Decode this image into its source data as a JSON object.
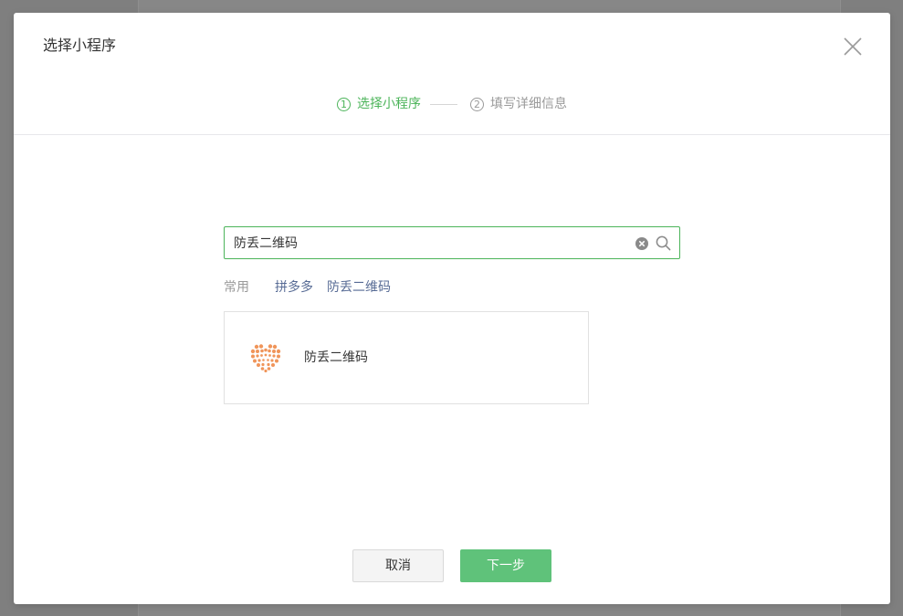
{
  "dialog": {
    "title": "选择小程序",
    "close_icon": "close-icon"
  },
  "steps": [
    {
      "number": "1",
      "label": "选择小程序",
      "state": "active"
    },
    {
      "number": "2",
      "label": "填写详细信息",
      "state": "inactive"
    }
  ],
  "search": {
    "value": "防丢二维码",
    "placeholder": "",
    "clear_icon": "clear-icon",
    "search_icon": "search-icon"
  },
  "common": {
    "label": "常用",
    "links": [
      "拼多多",
      "防丢二维码"
    ]
  },
  "results": [
    {
      "name": "防丢二维码",
      "logo": "heart-dots-logo"
    }
  ],
  "buttons": {
    "cancel": "取消",
    "next": "下一步"
  },
  "colors": {
    "accent": "#4cb45a",
    "primary_button": "#5fc27a",
    "link": "#576b95",
    "logo": "#f0955a"
  }
}
